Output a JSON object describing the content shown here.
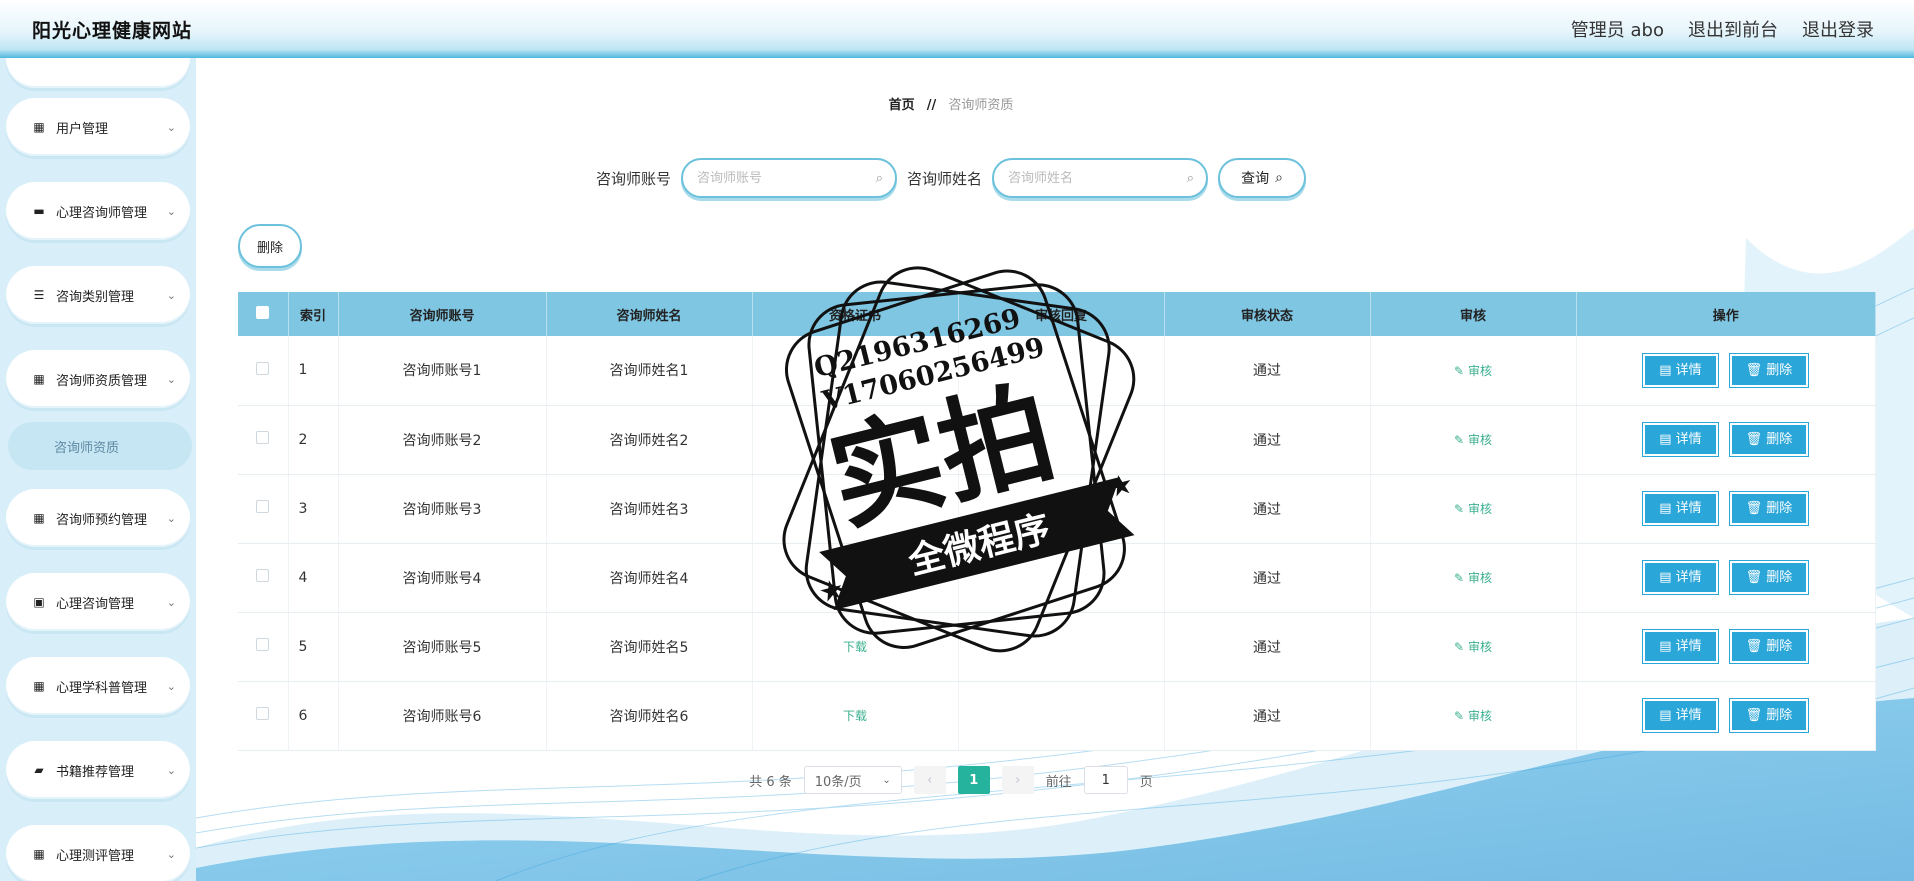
{
  "header": {
    "site_title": "阳光心理健康网站",
    "admin_label": "管理员 abo",
    "to_front": "退出到前台",
    "logout": "退出登录"
  },
  "sidebar": {
    "items": [
      {
        "label": "用户管理",
        "icon": "grid-icon"
      },
      {
        "label": "心理咨询师管理",
        "icon": "chat-icon"
      },
      {
        "label": "咨询类别管理",
        "icon": "list-icon"
      },
      {
        "label": "咨询师资质管理",
        "icon": "grid-icon"
      },
      {
        "label": "咨询师预约管理",
        "icon": "grid-icon"
      },
      {
        "label": "心理咨询管理",
        "icon": "clipboard-icon"
      },
      {
        "label": "心理学科普管理",
        "icon": "grid-icon"
      },
      {
        "label": "书籍推荐管理",
        "icon": "briefcase-icon"
      },
      {
        "label": "心理测评管理",
        "icon": "grid-icon"
      }
    ],
    "sub_item": "咨询师资质"
  },
  "breadcrumb": {
    "home": "首页",
    "sep": "//",
    "current": "咨询师资质"
  },
  "search": {
    "account_label": "咨询师账号",
    "account_placeholder": "咨询师账号",
    "name_label": "咨询师姓名",
    "name_placeholder": "咨询师姓名",
    "query_button": "查询"
  },
  "toolbar": {
    "delete_label": "删除"
  },
  "table": {
    "headers": [
      "索引",
      "咨询师账号",
      "咨询师姓名",
      "资格证书",
      "审核回复",
      "审核状态",
      "审核",
      "操作"
    ],
    "rows": [
      {
        "index": "1",
        "account": "咨询师账号1",
        "name": "咨询师姓名1",
        "cert": "",
        "reply": "",
        "status": "通过"
      },
      {
        "index": "2",
        "account": "咨询师账号2",
        "name": "咨询师姓名2",
        "cert": "",
        "reply": "",
        "status": "通过"
      },
      {
        "index": "3",
        "account": "咨询师账号3",
        "name": "咨询师姓名3",
        "cert": "",
        "reply": "",
        "status": "通过"
      },
      {
        "index": "4",
        "account": "咨询师账号4",
        "name": "咨询师姓名4",
        "cert": "下载",
        "reply": "",
        "status": "通过"
      },
      {
        "index": "5",
        "account": "咨询师账号5",
        "name": "咨询师姓名5",
        "cert": "下载",
        "reply": "",
        "status": "通过"
      },
      {
        "index": "6",
        "account": "咨询师账号6",
        "name": "咨询师姓名6",
        "cert": "下载",
        "reply": "",
        "status": "通过"
      }
    ],
    "review_link": "审核",
    "detail_button": "详情",
    "delete_button": "删除"
  },
  "pagination": {
    "total": "共 6 条",
    "page_size": "10条/页",
    "current_page": "1",
    "goto_prefix": "前往",
    "goto_value": "1",
    "goto_suffix": "页"
  },
  "watermark": {
    "line1": "Q2196316269",
    "line2": "V17060256499",
    "big": "实拍",
    "banner": "全微程序"
  },
  "colors": {
    "accent": "#2aa6d9",
    "table_header": "#7fc6e2",
    "pager_active": "#25b39e",
    "link_green": "#3bb08f",
    "sidebar_bg": "#d8eef8"
  }
}
